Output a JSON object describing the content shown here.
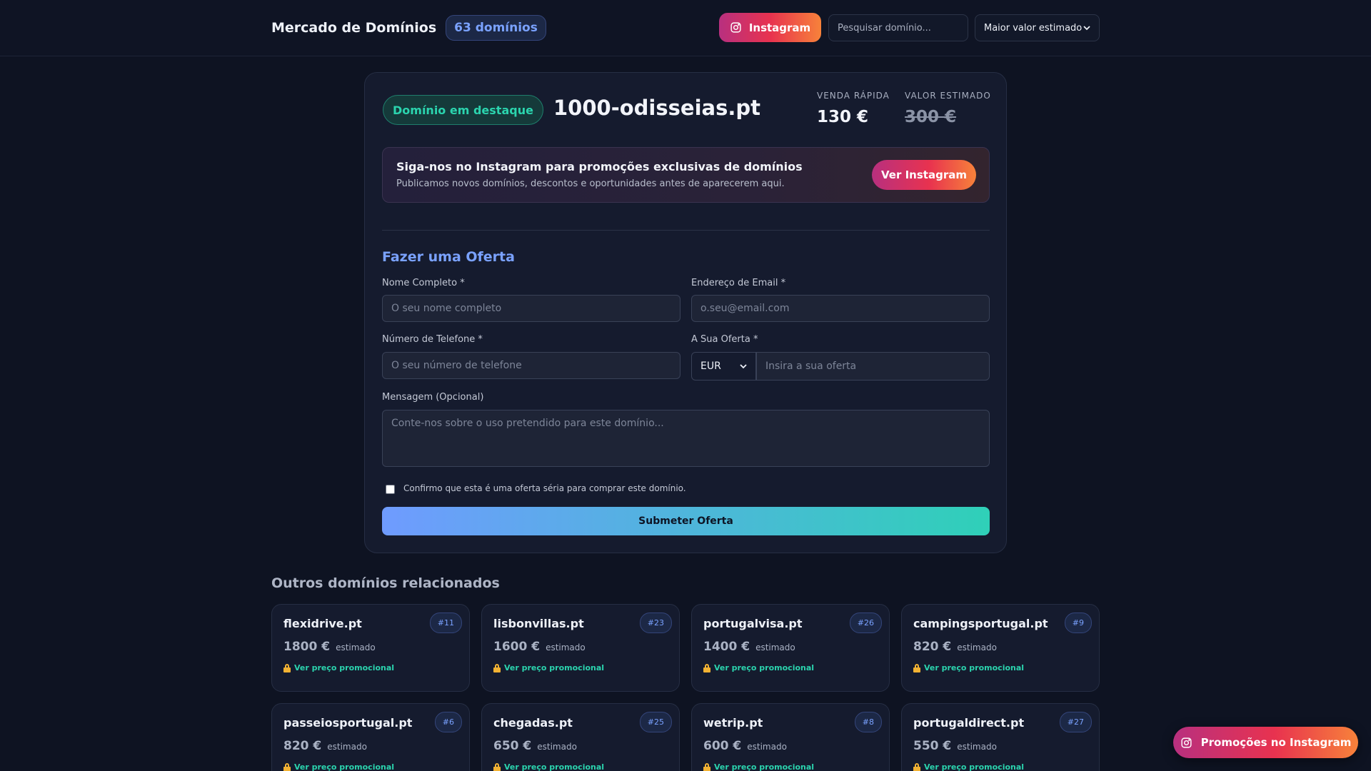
{
  "header": {
    "title": "Mercado de Domínios",
    "count": "63 domínios",
    "instagram_label": "Instagram",
    "search_placeholder": "Pesquisar domínio...",
    "sort_value": "Maior valor estimado"
  },
  "featured": {
    "badge": "Domínio em destaque",
    "domain": "1000-odisseias.pt",
    "quick_sale_label": "VENDA RÁPIDA",
    "quick_sale_price": "130 €",
    "estimated_label": "VALOR ESTIMADO",
    "estimated_price": "300 €"
  },
  "promo": {
    "title": "Siga-nos no Instagram para promoções exclusivas de domínios",
    "subtitle": "Publicamos novos domínios, descontos e oportunidades antes de aparecerem aqui.",
    "button": "Ver Instagram"
  },
  "form": {
    "title": "Fazer uma Oferta",
    "name_label": "Nome Completo *",
    "name_placeholder": "O seu nome completo",
    "email_label": "Endereço de Email *",
    "email_placeholder": "o.seu@email.com",
    "phone_label": "Número de Telefone *",
    "phone_placeholder": "O seu número de telefone",
    "offer_label": "A Sua Oferta *",
    "currency": "EUR",
    "offer_placeholder": "Insira a sua oferta",
    "message_label": "Mensagem (Opcional)",
    "message_placeholder": "Conte-nos sobre o uso pretendido para este domínio...",
    "confirm_label": "Confirmo que esta é uma oferta séria para comprar este domínio.",
    "submit": "Submeter Oferta"
  },
  "related": {
    "title": "Outros domínios relacionados",
    "estimated_note": "estimado",
    "promo_link": "Ver preço promocional",
    "items": [
      {
        "name": "flexidrive.pt",
        "rank": "#11",
        "price": "1800 €"
      },
      {
        "name": "lisbonvillas.pt",
        "rank": "#23",
        "price": "1600 €"
      },
      {
        "name": "portugalvisa.pt",
        "rank": "#26",
        "price": "1400 €"
      },
      {
        "name": "campingsportugal.pt",
        "rank": "#9",
        "price": "820 €"
      },
      {
        "name": "passeiosportugal.pt",
        "rank": "#6",
        "price": "820 €"
      },
      {
        "name": "chegadas.pt",
        "rank": "#25",
        "price": "650 €"
      },
      {
        "name": "wetrip.pt",
        "rank": "#8",
        "price": "600 €"
      },
      {
        "name": "portugaldirect.pt",
        "rank": "#27",
        "price": "550 €"
      }
    ]
  },
  "floating": {
    "label": "Promoções no Instagram"
  },
  "colors": {
    "background": "#0e1322",
    "accent_blue": "#7aa2ff",
    "accent_teal": "#2bd4ae",
    "instagram_gradient": [
      "#b8307f",
      "#e8324f",
      "#f7823a"
    ]
  }
}
